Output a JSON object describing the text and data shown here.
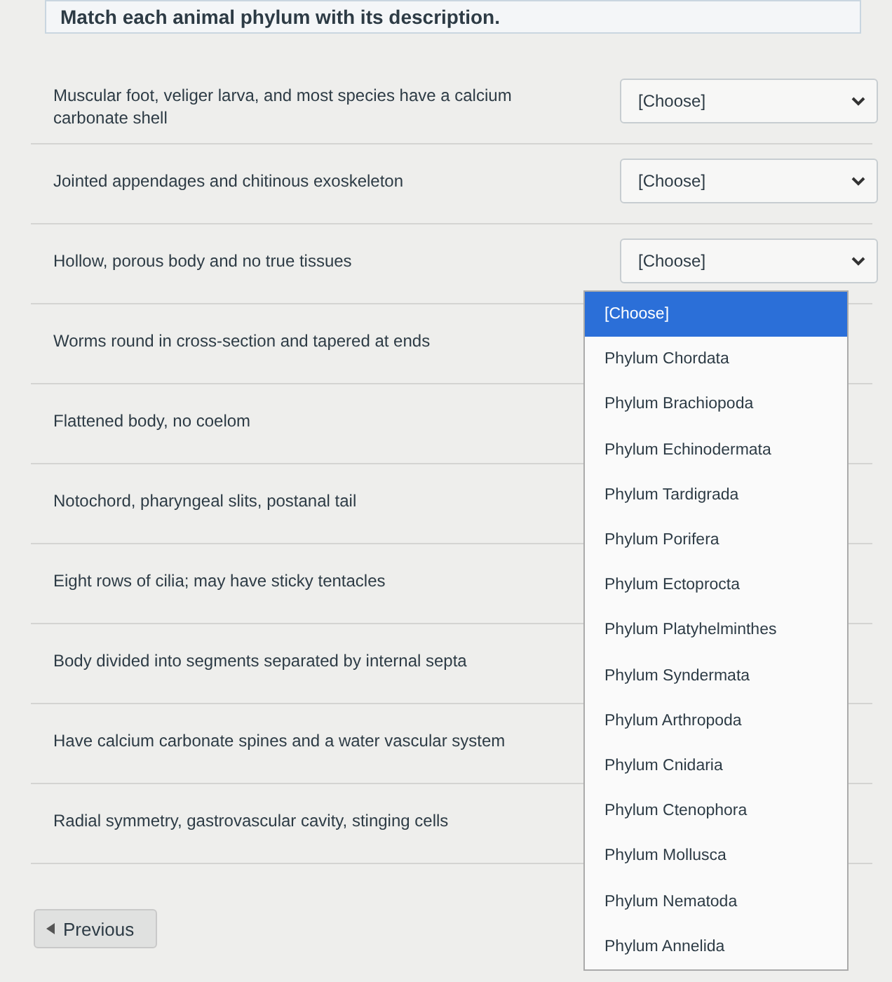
{
  "title": "Match each animal phylum with its description.",
  "rows": [
    {
      "description": "Muscular foot, veliger larva, and most species have a calcium carbonate shell",
      "value": "[Choose]"
    },
    {
      "description": "Jointed appendages and chitinous exoskeleton",
      "value": "[Choose]"
    },
    {
      "description": "Hollow, porous body and no true tissues",
      "value": "[Choose]",
      "options": [
        {
          "label": "[Choose]",
          "selected": true
        },
        {
          "label": "Phylum Chordata",
          "selected": false
        },
        {
          "label": "Phylum Brachiopoda",
          "selected": false
        },
        {
          "label": "Phylum Echinodermata",
          "selected": false
        },
        {
          "label": "Phylum Tardigrada",
          "selected": false
        },
        {
          "label": "Phylum Porifera",
          "selected": false
        },
        {
          "label": "Phylum Ectoprocta",
          "selected": false
        },
        {
          "label": "Phylum Platyhelminthes",
          "selected": false
        },
        {
          "label": "Phylum Syndermata",
          "selected": false
        },
        {
          "label": "Phylum Arthropoda",
          "selected": false
        },
        {
          "label": "Phylum Cnidaria",
          "selected": false
        },
        {
          "label": "Phylum Ctenophora",
          "selected": false
        },
        {
          "label": "Phylum Mollusca",
          "selected": false
        },
        {
          "label": "Phylum Nematoda",
          "selected": false
        },
        {
          "label": "Phylum Annelida",
          "selected": false
        }
      ]
    },
    {
      "description": "Worms round in cross-section and tapered at ends"
    },
    {
      "description": "Flattened body, no coelom"
    },
    {
      "description": "Notochord, pharyngeal slits, postanal tail"
    },
    {
      "description": "Eight rows of cilia; may have sticky tentacles"
    },
    {
      "description": "Body divided into segments separated by internal septa"
    },
    {
      "description": "Have calcium carbonate spines and a water vascular system"
    },
    {
      "description": "Radial symmetry, gastrovascular cavity, stinging cells"
    }
  ],
  "previous_button": "Previous"
}
